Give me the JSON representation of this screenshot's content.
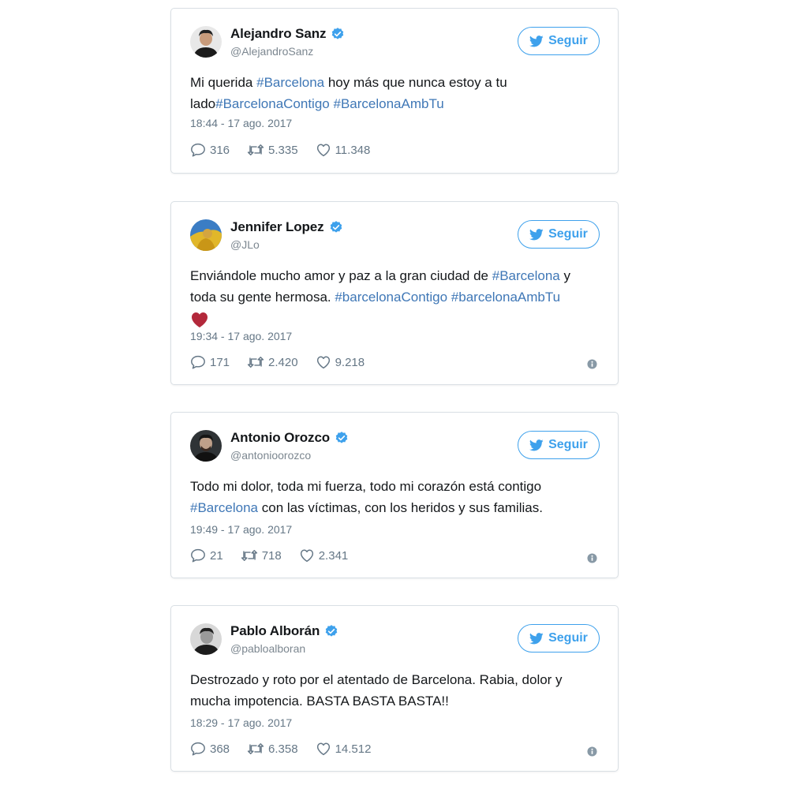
{
  "colors": {
    "twitter_blue": "#3ea1ec",
    "hashtag_blue": "#3f77b6",
    "muted_gray": "#657786",
    "card_border": "#d9dfe4"
  },
  "follow_label": "Seguir",
  "tweets": [
    {
      "display_name": "Alejandro Sanz",
      "handle": "@AlejandroSanz",
      "verified": true,
      "text_parts": [
        "Mi querida ",
        "#Barcelona",
        " hoy más que nunca estoy a tu lado",
        "#BarcelonaContigo",
        " ",
        "#BarcelonaAmbTu"
      ],
      "timestamp": "18:44 - 17 ago. 2017",
      "replies": "316",
      "retweets": "5.335",
      "likes": "11.348",
      "avatar_icon": "avatar-alejandro"
    },
    {
      "display_name": "Jennifer Lopez",
      "handle": "@JLo",
      "verified": true,
      "text_parts": [
        "Enviándole mucho amor y paz a la gran ciudad de ",
        "#Barcelona",
        " y toda su gente hermosa. ",
        "#barcelonaContigo",
        " ",
        "#barcelonaAmbTu"
      ],
      "timestamp": "19:34 - 17 ago. 2017",
      "replies": "171",
      "retweets": "2.420",
      "likes": "9.218",
      "avatar_icon": "avatar-jlo"
    },
    {
      "display_name": "Antonio Orozco",
      "handle": "@antonioorozco",
      "verified": true,
      "text_parts": [
        "Todo mi dolor, toda mi fuerza, todo mi corazón está contigo ",
        "#Barcelona",
        " con las víctimas, con los heridos y sus familias."
      ],
      "timestamp": "19:49 - 17 ago. 2017",
      "replies": "21",
      "retweets": "718",
      "likes": "2.341",
      "avatar_icon": "avatar-antonio"
    },
    {
      "display_name": "Pablo Alborán",
      "handle": "@pabloalboran",
      "verified": true,
      "text_parts": [
        "Destrozado y roto por el atentado de Barcelona. Rabia, dolor y mucha impotencia. BASTA BASTA BASTA!!"
      ],
      "timestamp": "18:29 - 17 ago. 2017",
      "replies": "368",
      "retweets": "6.358",
      "likes": "14.512",
      "avatar_icon": "avatar-pablo"
    }
  ]
}
